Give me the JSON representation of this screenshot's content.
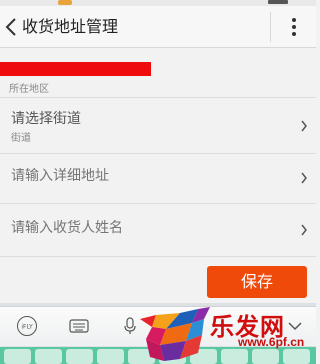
{
  "header": {
    "title": "收货地址管理",
    "back_icon": "chevron-left-icon",
    "menu_icon": "overflow-menu-icon"
  },
  "address": {
    "region_label": "所在地区",
    "street": {
      "placeholder": "请选择街道",
      "sub_label": "街道"
    },
    "detail": {
      "placeholder": "请输入详细地址"
    },
    "recipient": {
      "placeholder": "请输入收货人姓名"
    }
  },
  "actions": {
    "save_label": "保存"
  },
  "colors": {
    "accent": "#f04a0b",
    "name_redaction": "#ee0c0c",
    "keyboard_keys": "#5ac7a3"
  },
  "keyboard": {
    "brand_label": "iFLY",
    "icons": [
      "ifly-logo-icon",
      "keyboard-icon",
      "microphone-icon",
      "chevron-down-icon"
    ]
  },
  "watermark": {
    "brand": "乐发网",
    "url": "www.6pf.cn"
  }
}
